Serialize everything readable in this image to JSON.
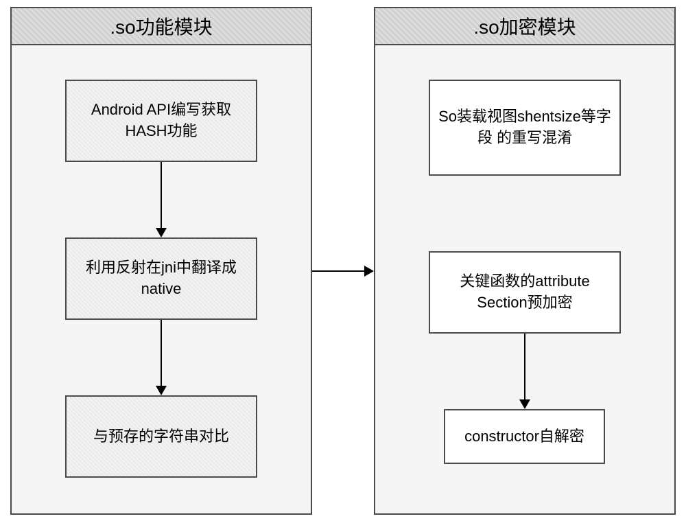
{
  "leftModule": {
    "title": ".so功能模块",
    "boxes": [
      "Android API编写获取HASH功能",
      "利用反射在jni中翻译成native",
      "与预存的字符串对比"
    ]
  },
  "rightModule": {
    "title": ".so加密模块",
    "boxes": [
      "So装载视图shentsize等字段\n的重写混淆",
      "关键函数的attribute Section预加密",
      "constructor自解密"
    ]
  }
}
